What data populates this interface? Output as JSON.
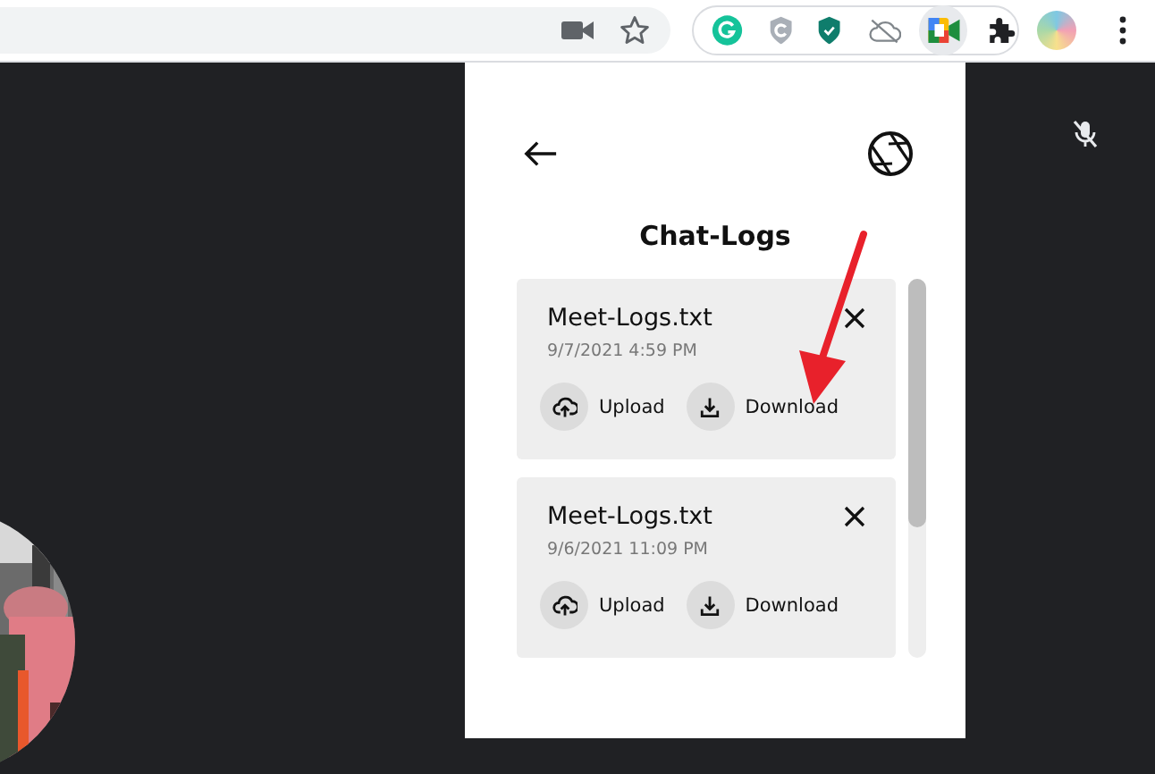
{
  "popup": {
    "title": "Chat-Logs",
    "logs": [
      {
        "name": "Meet-Logs.txt",
        "time": "9/7/2021 4:59 PM",
        "actions": [
          {
            "kind": "upload",
            "label": "Upload"
          },
          {
            "kind": "download",
            "label": "Download"
          }
        ]
      },
      {
        "name": "Meet-Logs.txt",
        "time": "9/6/2021 11:09 PM",
        "actions": [
          {
            "kind": "upload",
            "label": "Upload"
          },
          {
            "kind": "download",
            "label": "Download"
          }
        ]
      }
    ]
  }
}
